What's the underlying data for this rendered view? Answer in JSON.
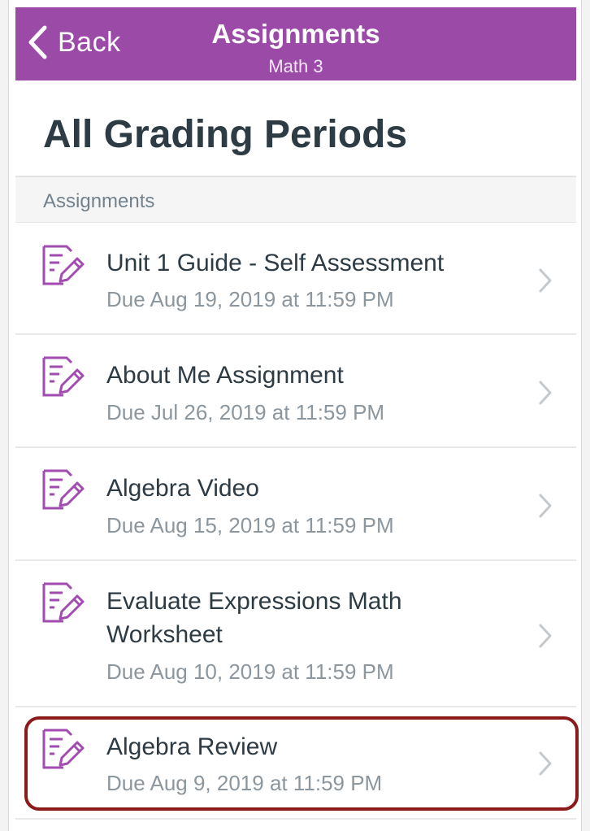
{
  "navbar": {
    "back_label": "Back",
    "title": "Assignments",
    "subtitle": "Math 3",
    "bg_color": "#9b4aa8"
  },
  "page": {
    "title": "All Grading Periods"
  },
  "section": {
    "label": "Assignments"
  },
  "assignments": [
    {
      "title": "Unit 1 Guide - Self Assessment",
      "due": "Due Aug 19, 2019 at 11:59 PM",
      "icon": "assignment-icon"
    },
    {
      "title": "About Me Assignment",
      "due": "Due Jul 26, 2019 at 11:59 PM",
      "icon": "assignment-icon"
    },
    {
      "title": "Algebra Video",
      "due": "Due Aug 15, 2019 at 11:59 PM",
      "icon": "assignment-icon"
    },
    {
      "title": "Evaluate Expressions Math Worksheet",
      "due": "Due Aug 10, 2019 at 11:59 PM",
      "icon": "assignment-icon"
    },
    {
      "title": "Algebra Review",
      "due": "Due Aug 9, 2019 at 11:59 PM",
      "icon": "assignment-icon"
    }
  ],
  "colors": {
    "accent": "#9b4aa8",
    "highlight": "#8b1a1a",
    "title_text": "#2d3b45",
    "muted_text": "#8b969e"
  }
}
